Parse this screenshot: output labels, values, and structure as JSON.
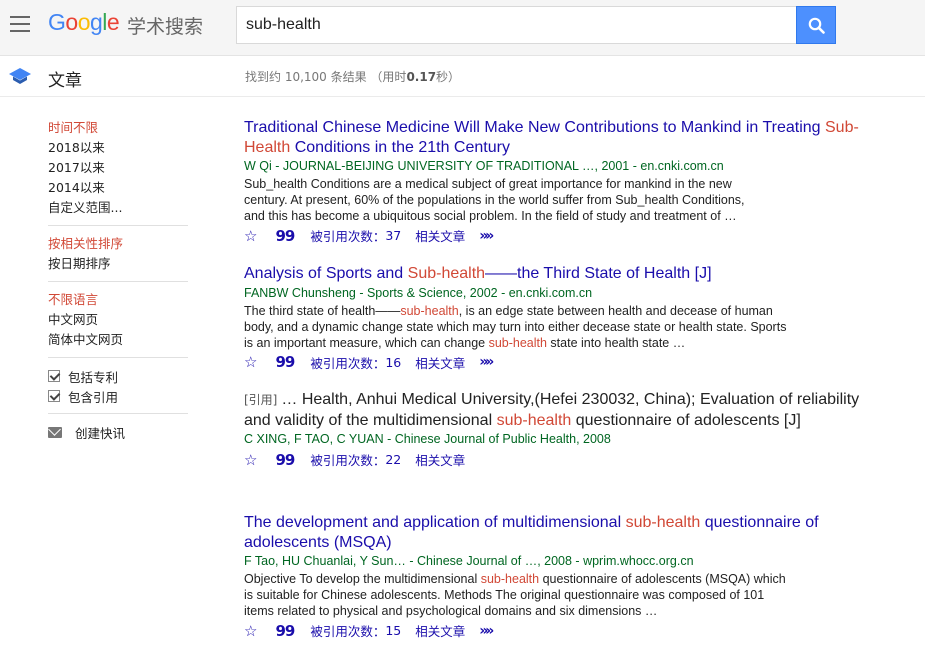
{
  "header": {
    "logo": {
      "G": "G",
      "o1": "o",
      "o2": "o",
      "g": "g",
      "l": "l",
      "e": "e"
    },
    "logo_sub": "学术搜索",
    "search_value": "sub-health"
  },
  "subheader": {
    "section_title": "文章",
    "stats_prefix": "找到约 10,100 条结果 （用时",
    "stats_time": "0.17",
    "stats_suffix": "秒）"
  },
  "sidebar": {
    "time_filters": [
      {
        "label": "时间不限",
        "active": true
      },
      {
        "label": "2018以来"
      },
      {
        "label": "2017以来"
      },
      {
        "label": "2014以来"
      },
      {
        "label": "自定义范围..."
      }
    ],
    "sort_filters": [
      {
        "label": "按相关性排序",
        "active": true
      },
      {
        "label": "按日期排序"
      }
    ],
    "lang_filters": [
      {
        "label": "不限语言",
        "active": true
      },
      {
        "label": "中文网页"
      },
      {
        "label": "简体中文网页"
      }
    ],
    "checkboxes": [
      {
        "label": "包括专利"
      },
      {
        "label": "包含引用"
      }
    ],
    "create_alert": "创建快讯"
  },
  "action_labels": {
    "cited_prefix": "被引用次数：",
    "related": "相关文章"
  },
  "results": [
    {
      "title_parts": [
        "Traditional Chinese Medicine Will Make New Contributions to Mankind in Treating ",
        "Sub-Health",
        " Conditions in the 21th Century"
      ],
      "meta": "W Qi - JOURNAL-BEIJING UNIVERSITY OF TRADITIONAL …, 2001 - en.cnki.com.cn",
      "snippet_parts": [
        "Sub_health Conditions are a medical subject of great importance for mankind in the new century. At present, 60% of the populations in the world suffer from Sub_health Conditions, and this has become a ubiquitous social problem. In the field of study and treatment of …"
      ],
      "cited": "37"
    },
    {
      "title_parts": [
        "Analysis of Sports and ",
        "Sub-health",
        "——the Third State of Health [J]"
      ],
      "meta": "FANBW Chunsheng - Sports & Science, 2002 - en.cnki.com.cn",
      "snippet_parts": [
        "The third state of health——",
        "sub-health",
        ", is an edge state between health and decease of human body, and a dynamic change state which may turn into either decease state or health state. Sports is an important measure, which can change ",
        "sub-health",
        " state into health state …"
      ],
      "cited": "16"
    },
    {
      "tag": "[引用]",
      "title_parts": [
        "… Health, Anhui Medical University,(Hefei 230032, China); Evaluation of reliability and validity of the multidimensional ",
        "sub-health",
        " questionnaire of adolescents [J]"
      ],
      "meta": "C XING, F TAO, C YUAN - Chinese Journal of Public Health, 2008",
      "cited": "22"
    },
    {
      "title_parts": [
        "The development and application of multidimensional ",
        "sub-health",
        " questionnaire of adolescents (MSQA)"
      ],
      "meta": "F Tao, HU Chuanlai, Y Sun… - Chinese Journal of …, 2008 - wprim.whocc.org.cn",
      "snippet_parts": [
        "Objective To develop the multidimensional ",
        "sub-health",
        " questionnaire of adolescents (MSQA) which is suitable for Chinese adolescents. Methods The original questionnaire was composed of 101 items related to physical and psychological domains and six dimensions …"
      ],
      "cited": "15"
    }
  ]
}
